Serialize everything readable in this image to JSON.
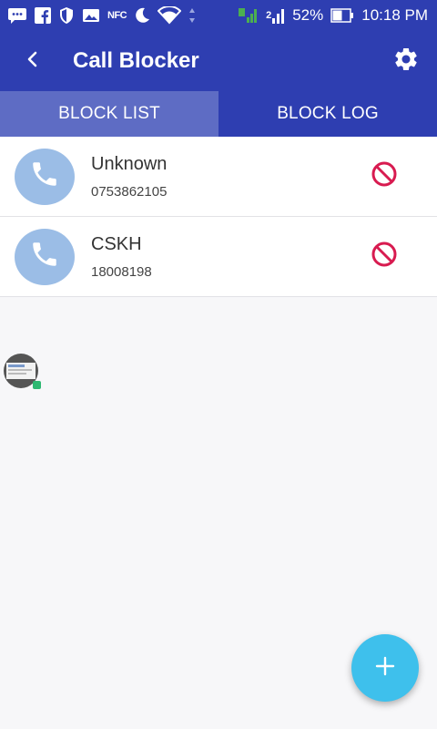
{
  "status_bar": {
    "battery": "52%",
    "time": "10:18 PM",
    "nfc": "NFC",
    "sim": "2"
  },
  "app_bar": {
    "title": "Call Blocker"
  },
  "tabs": [
    {
      "label": "BLOCK LIST",
      "active": true
    },
    {
      "label": "BLOCK LOG",
      "active": false
    }
  ],
  "block_list": [
    {
      "name": "Unknown",
      "number": "0753862105"
    },
    {
      "name": "CSKH",
      "number": "18008198"
    }
  ],
  "colors": {
    "primary": "#2e3eb1",
    "active_tab": "#5e6cc4",
    "avatar": "#9bbde6",
    "block_icon": "#d81b50",
    "fab": "#3ec0ec"
  },
  "icons": {
    "back": "back-arrow-icon",
    "settings": "gear-icon",
    "contact": "phone-icon",
    "block": "block-icon",
    "fab": "plus-icon"
  }
}
